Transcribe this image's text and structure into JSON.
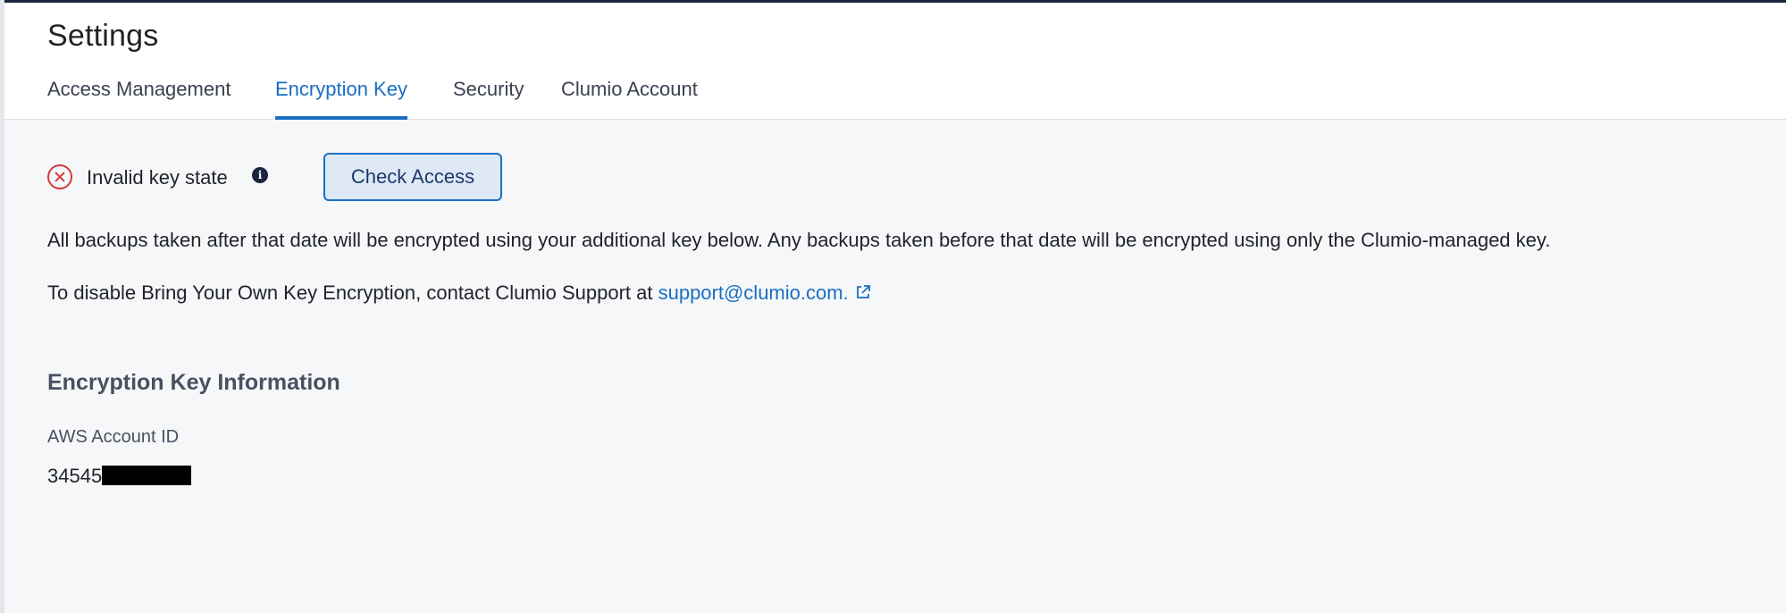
{
  "header": {
    "title": "Settings",
    "tabs": [
      {
        "label": "Access Management",
        "active": false
      },
      {
        "label": "Encryption Key",
        "active": true
      },
      {
        "label": "Security",
        "active": false
      },
      {
        "label": "Clumio Account",
        "active": false
      }
    ]
  },
  "status": {
    "icon": "error-circle-icon",
    "text": "Invalid key state",
    "info_icon": "info-icon",
    "button_label": "Check Access"
  },
  "messages": {
    "backups_note": "All backups taken after that date will be encrypted using your additional key below. Any backups taken before that date will be encrypted using only the Clumio-managed key.",
    "disable_prefix": "To disable Bring Your Own Key Encryption, contact Clumio Support at ",
    "support_link": "support@clumio.com.",
    "link_icon": "external-link-icon"
  },
  "key_info": {
    "section_title": "Encryption Key Information",
    "aws_account_label": "AWS Account ID",
    "aws_account_value": "34545"
  },
  "colors": {
    "accent": "#1a6fc2",
    "error": "#d33a3a",
    "top_bar": "#1c2540",
    "background": "#f6f7f9"
  }
}
